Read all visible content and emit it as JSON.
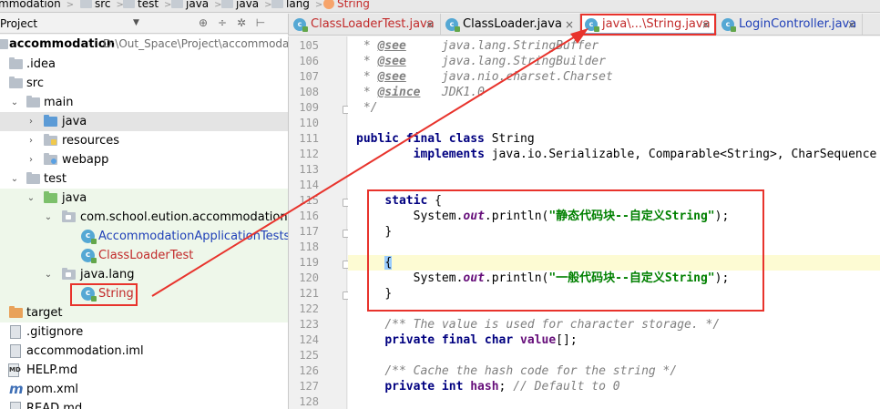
{
  "breadcrumbs": [
    {
      "label": "mmodation",
      "icon": "folder-icon"
    },
    {
      "label": "src",
      "icon": "folder-icon"
    },
    {
      "label": "test",
      "icon": "folder-icon"
    },
    {
      "label": "java",
      "icon": "folder-icon"
    },
    {
      "label": "java",
      "icon": "package-icon"
    },
    {
      "label": "lang",
      "icon": "package-icon"
    },
    {
      "label": "String",
      "icon": "class-icon"
    }
  ],
  "project_panel": {
    "title": "Project",
    "tree": [
      {
        "label": "accommodation",
        "path": "D:\\Out_Space\\Project\\accommodat"
      },
      {
        "label": ".idea"
      },
      {
        "label": "src"
      },
      {
        "label": "main"
      },
      {
        "label": "java"
      },
      {
        "label": "resources"
      },
      {
        "label": "webapp"
      },
      {
        "label": "test"
      },
      {
        "label": "java"
      },
      {
        "label": "com.school.eution.accommodation"
      },
      {
        "label": "AccommodationApplicationTests"
      },
      {
        "label": "ClassLoaderTest"
      },
      {
        "label": "java.lang"
      },
      {
        "label": "String"
      },
      {
        "label": "target"
      },
      {
        "label": ".gitignore"
      },
      {
        "label": "accommodation.iml"
      },
      {
        "label": "HELP.md",
        "badge": "MD"
      },
      {
        "label": "pom.xml",
        "badge": "m"
      },
      {
        "label": "READ.md"
      }
    ]
  },
  "tabs": [
    {
      "label": "ClassLoaderTest.java",
      "close": "×"
    },
    {
      "label": "ClassLoader.java",
      "close": "×"
    },
    {
      "label": "java\\...\\String.java",
      "close": "×"
    },
    {
      "label": "LoginController.java",
      "close": "×"
    }
  ],
  "editor": {
    "line_numbers": [
      "105",
      "106",
      "107",
      "108",
      "109",
      "110",
      "111",
      "112",
      "113",
      "114",
      "115",
      "116",
      "117",
      "118",
      "119",
      "120",
      "121",
      "122",
      "123",
      "124",
      "125",
      "126",
      "127",
      "128"
    ],
    "lines": {
      "l105": {
        "a": " * ",
        "tag": "@see",
        "b": "     java.lang.StringBuffer"
      },
      "l106": {
        "a": " * ",
        "tag": "@see",
        "b": "     java.lang.StringBuilder"
      },
      "l107": {
        "a": " * ",
        "tag": "@see",
        "b": "     java.nio.charset.Charset"
      },
      "l108": {
        "a": " * ",
        "tag": "@since",
        "b": "   JDK1.0"
      },
      "l109": {
        "a": " */"
      },
      "l111": {
        "kw1": "public final class",
        "b": " String"
      },
      "l112": {
        "pad": "        ",
        "kw1": "implements",
        "b": " java.io.Serializable, Comparable<String>, CharSequence"
      },
      "l115": {
        "pad": "    ",
        "kw1": "static",
        "b": " {"
      },
      "l116": {
        "pad": "        ",
        "a": "System.",
        "fd": "out",
        "b": ".println(",
        "st": "\"静态代码块--自定义String\"",
        "c": ");"
      },
      "l117": {
        "pad": "    ",
        "a": "}"
      },
      "l119": {
        "pad": "    ",
        "br": "{"
      },
      "l120": {
        "pad": "        ",
        "a": "System.",
        "fd": "out",
        "b": ".println(",
        "st": "\"一般代码块--自定义String\"",
        "c": ");"
      },
      "l121": {
        "pad": "    ",
        "a": "}"
      },
      "l123": {
        "pad": "    ",
        "cm": "/** The value is used for character storage. */"
      },
      "l124": {
        "pad": "    ",
        "kw1": "private final char",
        "b": " ",
        "fv": "value",
        "c": "[];"
      },
      "l126": {
        "pad": "    ",
        "cm": "/** Cache the hash code for the string */"
      },
      "l127": {
        "pad": "    ",
        "kw1": "private int",
        "b": " ",
        "fv": "hash",
        "c": "; ",
        "cm2": "// Default to 0"
      }
    }
  },
  "colors": {
    "annotation_red": "#e8332c",
    "keyword": "#000080",
    "string": "#008000",
    "field": "#660e7a",
    "comment": "#808080"
  }
}
